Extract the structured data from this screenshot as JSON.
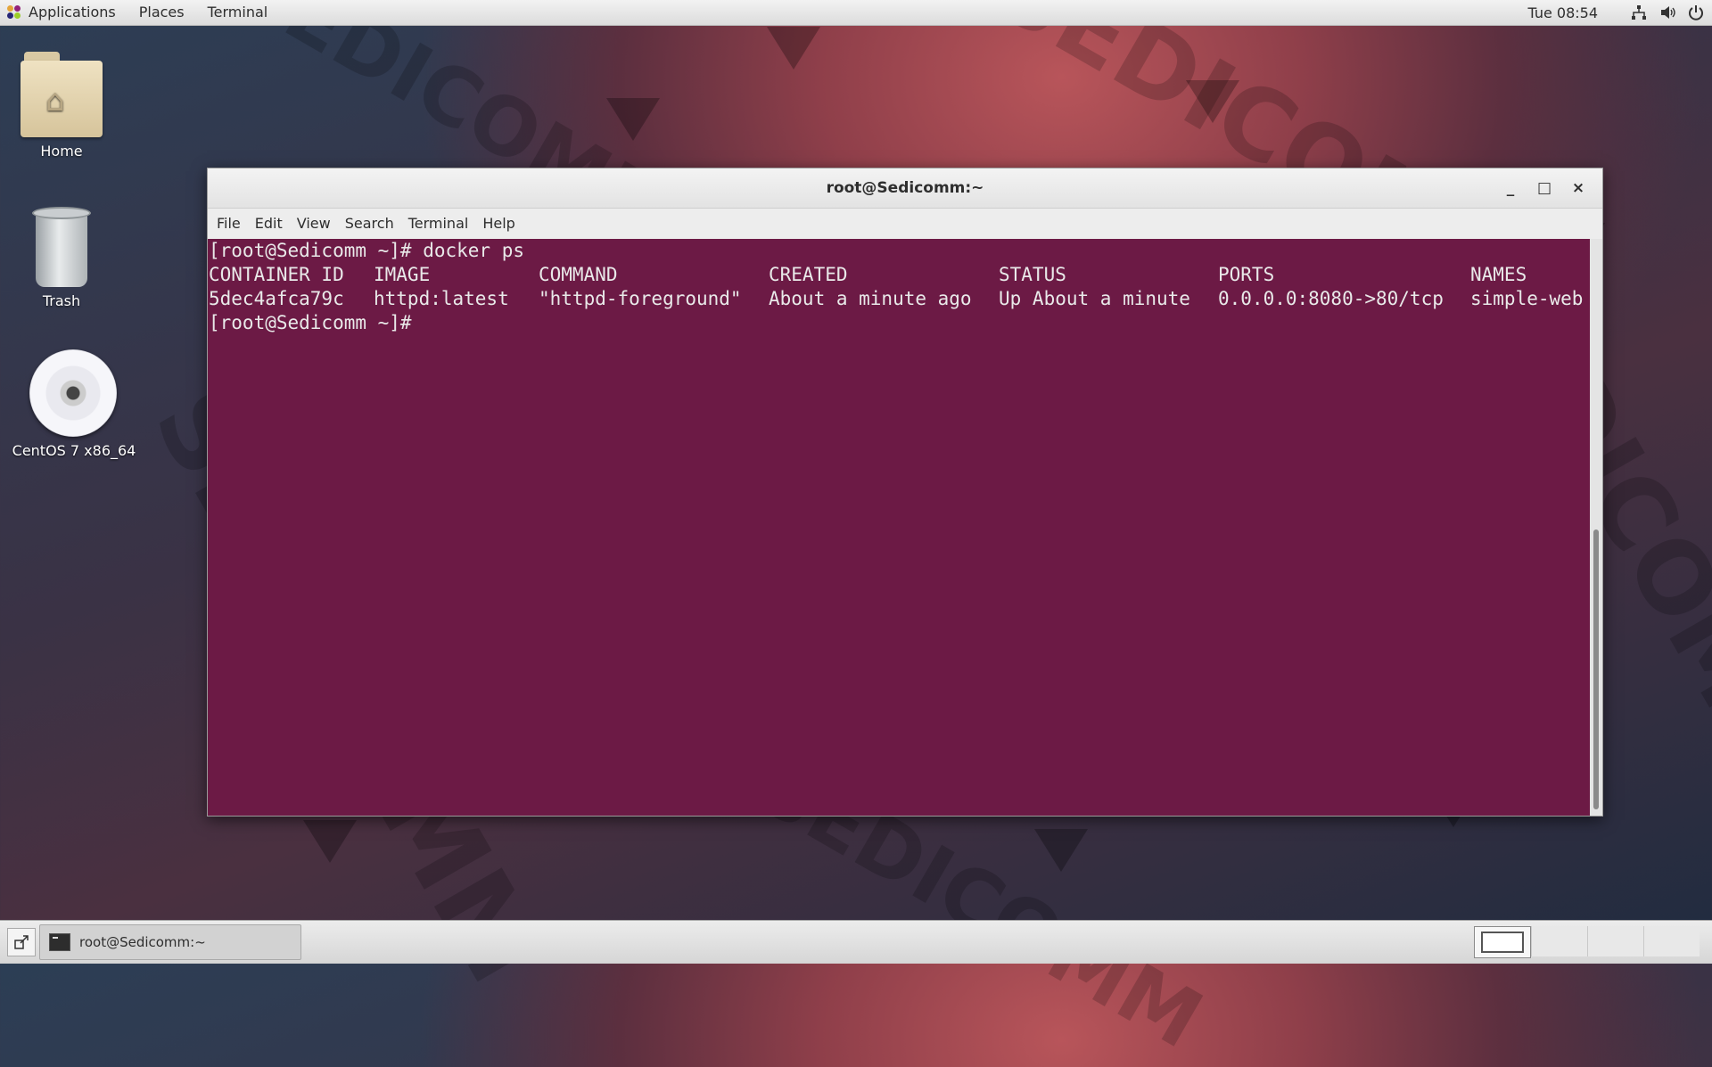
{
  "top_panel": {
    "applications": "Applications",
    "places": "Places",
    "terminal": "Terminal",
    "clock": "Tue 08:54",
    "icons": [
      "network-icon",
      "volume-icon",
      "power-icon"
    ]
  },
  "desktop": {
    "icons": [
      {
        "label": "Home",
        "icon": "home-folder-icon"
      },
      {
        "label": "Trash",
        "icon": "trash-icon"
      },
      {
        "label": "CentOS 7 x86_64",
        "icon": "disc-icon"
      }
    ]
  },
  "window": {
    "title": "root@Sedicomm:~",
    "controls": {
      "minimize": "_",
      "maximize": "□",
      "close": "×"
    },
    "menu": [
      "File",
      "Edit",
      "View",
      "Search",
      "Terminal",
      "Help"
    ]
  },
  "terminal": {
    "prompt1": "[root@Sedicomm ~]# docker ps",
    "headers": [
      "CONTAINER ID",
      "IMAGE",
      "COMMAND",
      "CREATED",
      "STATUS",
      "PORTS",
      "NAMES"
    ],
    "row": [
      "5dec4afca79c",
      "httpd:latest",
      "\"httpd-foreground\"",
      "About a minute ago",
      "Up About a minute",
      "0.0.0.0:8080->80/tcp",
      "simple-web"
    ],
    "prompt2": "[root@Sedicomm ~]#"
  },
  "taskbar": {
    "task_label": "root@Sedicomm:~"
  },
  "colors": {
    "terminal_bg": "#6c1a45",
    "terminal_fg": "#e9e9e9"
  }
}
